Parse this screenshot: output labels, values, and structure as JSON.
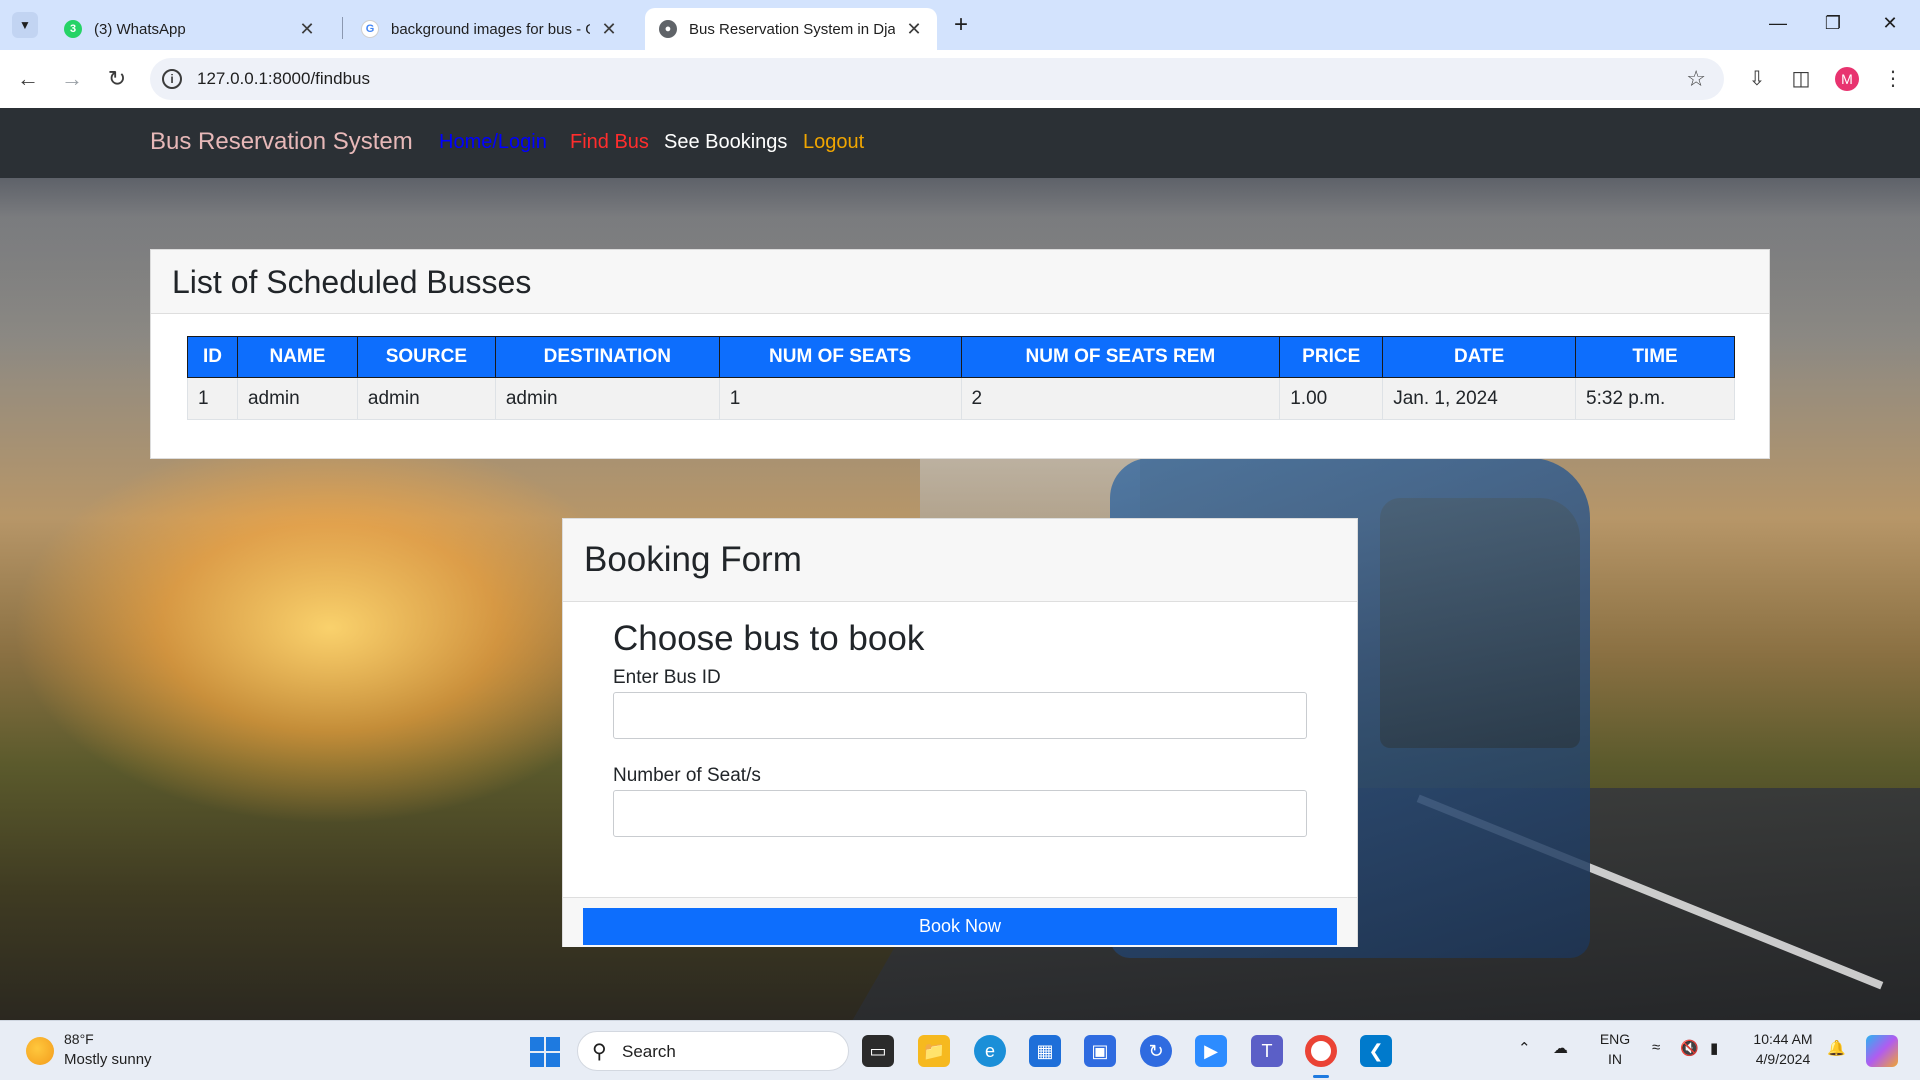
{
  "browser": {
    "tabs": [
      {
        "title": "(3) WhatsApp",
        "icon": "whatsapp-icon",
        "badge": "3"
      },
      {
        "title": "background images for bus - Go",
        "icon": "google-icon"
      },
      {
        "title": "Bus Reservation System in Djan",
        "icon": "globe-icon"
      }
    ],
    "url": "127.0.0.1:8000/findbus",
    "profile_initial": "M",
    "profile_color": "#e8336f"
  },
  "nav": {
    "brand": "Bus Reservation System",
    "links": [
      {
        "label": "Home/Login",
        "color": "#0000ff"
      },
      {
        "label": "Find Bus",
        "color": "#ff2d2d"
      },
      {
        "label": "See Bookings",
        "color": "#ffffff"
      },
      {
        "label": "Logout",
        "color": "#f0a500"
      }
    ]
  },
  "schedule": {
    "title": "List of Scheduled Busses",
    "columns": [
      "ID",
      "NAME",
      "SOURCE",
      "DESTINATION",
      "NUM OF SEATS",
      "NUM OF SEATS REM",
      "PRICE",
      "DATE",
      "TIME"
    ],
    "rows": [
      [
        "1",
        "admin",
        "admin",
        "admin",
        "1",
        "2",
        "1.00",
        "Jan. 1, 2024",
        "5:32 p.m."
      ]
    ]
  },
  "booking": {
    "title": "Booking Form",
    "subtitle": "Choose bus to book",
    "bus_id_label": "Enter Bus ID",
    "bus_id_value": "",
    "seats_label": "Number of Seat/s",
    "seats_value": "",
    "button": "Book Now",
    "accent": "#0d6efd"
  },
  "taskbar": {
    "temperature": "88°F",
    "condition": "Mostly sunny",
    "search_placeholder": "Search",
    "lang_top": "ENG",
    "lang_bottom": "IN",
    "time": "10:44 AM",
    "date": "4/9/2024"
  }
}
